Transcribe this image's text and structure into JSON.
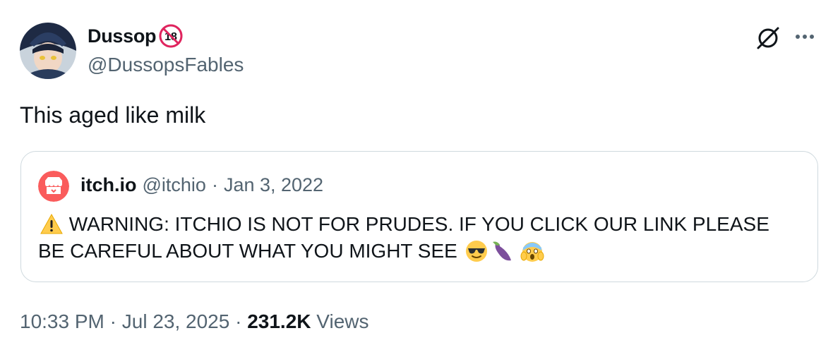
{
  "author": {
    "display_name": "Dussop",
    "handle": "@DussopsFables",
    "badge_icon": "no-under-18-icon"
  },
  "tweet": {
    "text": "This aged like milk"
  },
  "quoted_tweet": {
    "author_name": "itch.io",
    "author_handle": "@itchio",
    "separator": "·",
    "date": "Jan 3, 2022",
    "text": "WARNING: ITCHIO IS NOT FOR PRUDES. IF YOU CLICK OUR LINK PLEASE BE CAREFUL ABOUT WHAT YOU MIGHT SEE",
    "leading_emoji": "warning-emoji",
    "trailing_emojis": [
      "sunglasses-face-emoji",
      "eggplant-emoji",
      "screaming-face-emoji"
    ]
  },
  "footer": {
    "time": "10:33 PM",
    "separator": "·",
    "date": "Jul 23, 2025",
    "views_count": "231.2K",
    "views_label": "Views"
  },
  "colors": {
    "text_primary": "#0f1419",
    "text_secondary": "#536471",
    "border": "#cfd9de",
    "itchio_red": "#fa5c5c"
  }
}
